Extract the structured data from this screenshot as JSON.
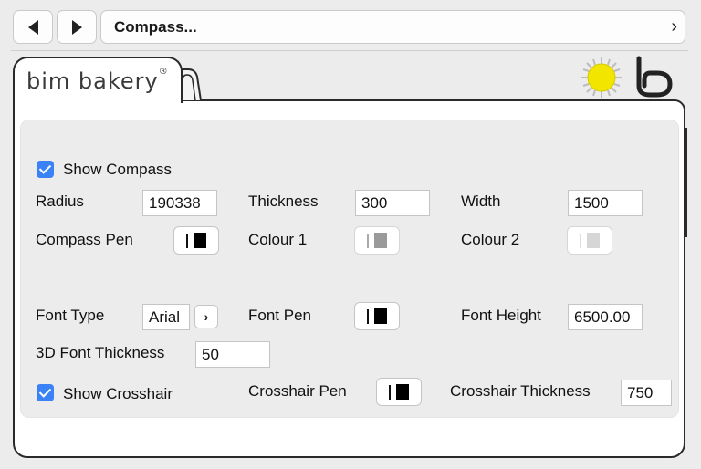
{
  "nav": {
    "path_title": "Compass..."
  },
  "tab": {
    "brand": "bim bakery",
    "brand_mark": "®"
  },
  "form": {
    "show_compass": {
      "label": "Show Compass",
      "checked": true
    },
    "radius": {
      "label": "Radius",
      "value": "190338"
    },
    "thickness": {
      "label": "Thickness",
      "value": "300"
    },
    "width": {
      "label": "Width",
      "value": "1500"
    },
    "compass_pen": {
      "label": "Compass Pen"
    },
    "colour1": {
      "label": "Colour 1"
    },
    "colour2": {
      "label": "Colour 2"
    },
    "font_type": {
      "label": "Font Type",
      "value": "Arial"
    },
    "font_pen": {
      "label": "Font Pen"
    },
    "font_height": {
      "label": "Font Height",
      "value": "6500.00"
    },
    "font_thickness_3d": {
      "label": "3D Font Thickness",
      "value": "50"
    },
    "show_crosshair": {
      "label": "Show Crosshair",
      "checked": true
    },
    "crosshair_pen": {
      "label": "Crosshair Pen"
    },
    "crosshair_thickness": {
      "label": "Crosshair Thickness",
      "value": "750"
    }
  },
  "colors": {
    "accent": "#3b82f6",
    "sun": "#f2e600"
  }
}
